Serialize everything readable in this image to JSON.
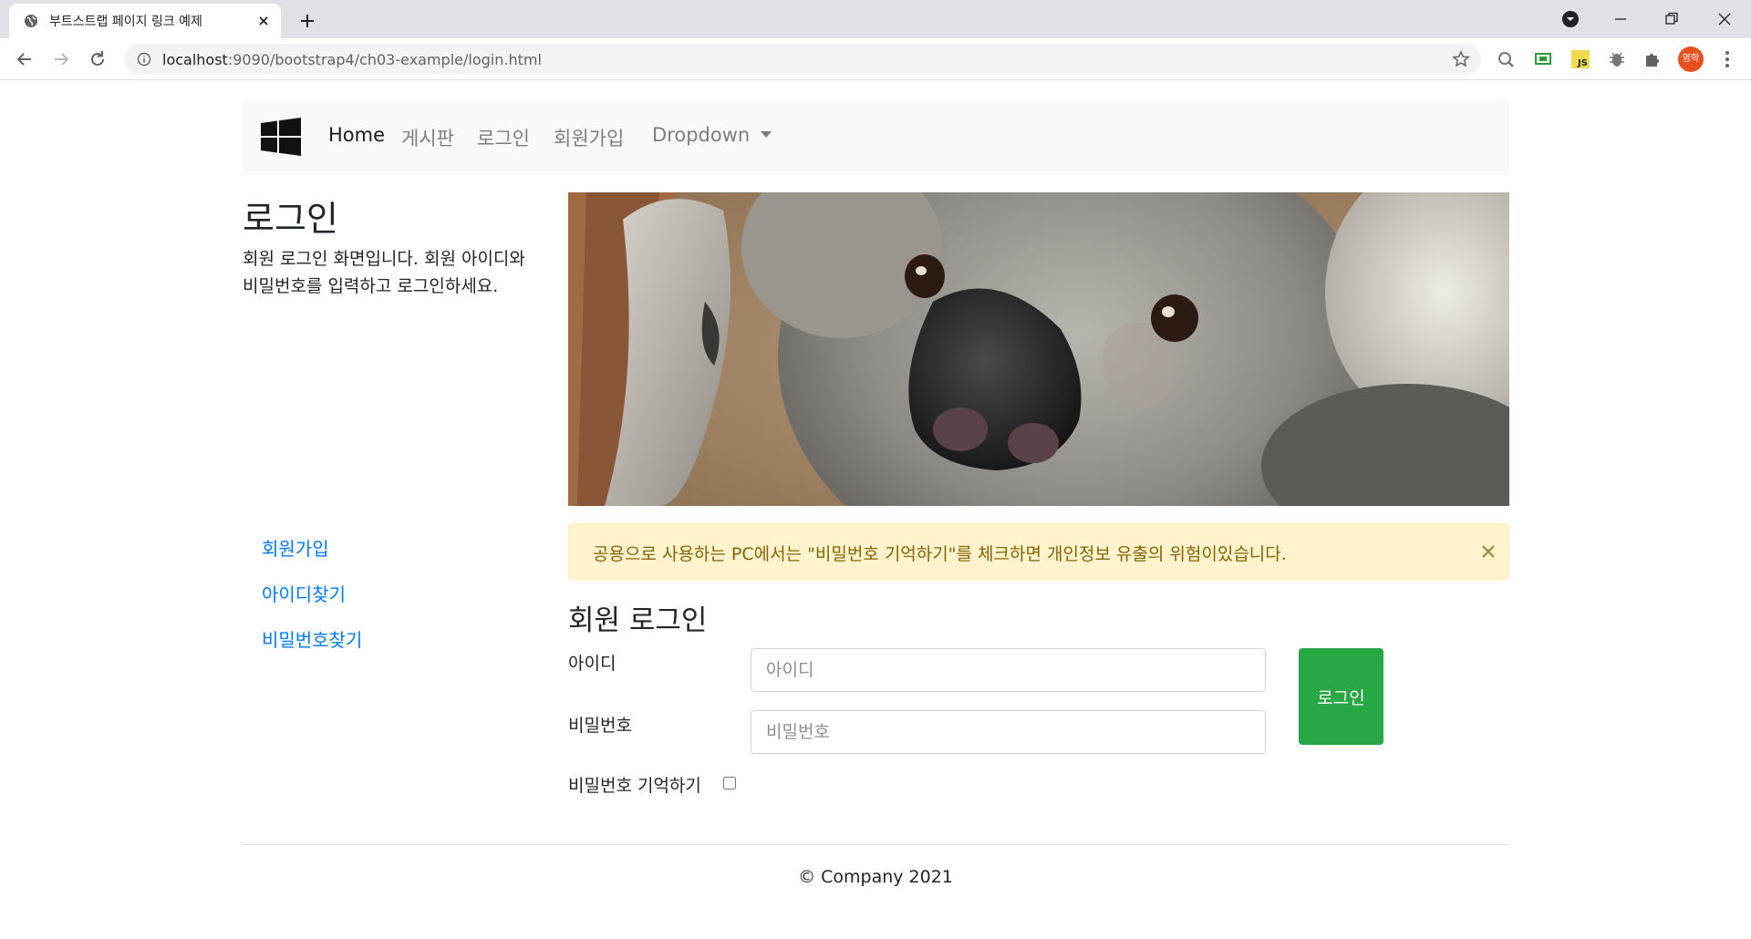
{
  "browser": {
    "tab_title": "부트스트랩 페이지 링크 예제",
    "url_host": "localhost",
    "url_rest": ":9090/bootstrap4/ch03-example/login.html",
    "profile_initials": "영학"
  },
  "navbar": {
    "brand_icon": "windows-logo-icon",
    "items": [
      {
        "label": "Home",
        "active": true
      },
      {
        "label": "게시판"
      },
      {
        "label": "로그인"
      },
      {
        "label": "회원가입"
      },
      {
        "label": "Dropdown",
        "dropdown": true
      }
    ]
  },
  "sidebar": {
    "heading": "로그인",
    "description": "회원 로그인 화면입니다. 회원 아이디와 비밀번호를 입력하고 로그인하세요.",
    "links": [
      "회원가입",
      "아이디찾기",
      "비밀번호찾기"
    ]
  },
  "hero": {
    "image": "koala-photo"
  },
  "alert": {
    "text": "공용으로 사용하는 PC에서는 \"비밀번호 기억하기\"를 체크하면 개인정보 유출의 위험이있습니다.",
    "close": "×"
  },
  "login_form": {
    "title": "회원 로그인",
    "id_label": "아이디",
    "id_placeholder": "아이디",
    "pw_label": "비밀번호",
    "pw_placeholder": "비밀번호",
    "remember_label": "비밀번호 기억하기",
    "submit_label": "로그인"
  },
  "footer": {
    "text": "© Company 2021"
  },
  "colors": {
    "link": "#007bff",
    "success": "#28a745",
    "alert_bg": "#fff3cd",
    "alert_text": "#856404",
    "navbar_bg": "#f8f9fa"
  }
}
